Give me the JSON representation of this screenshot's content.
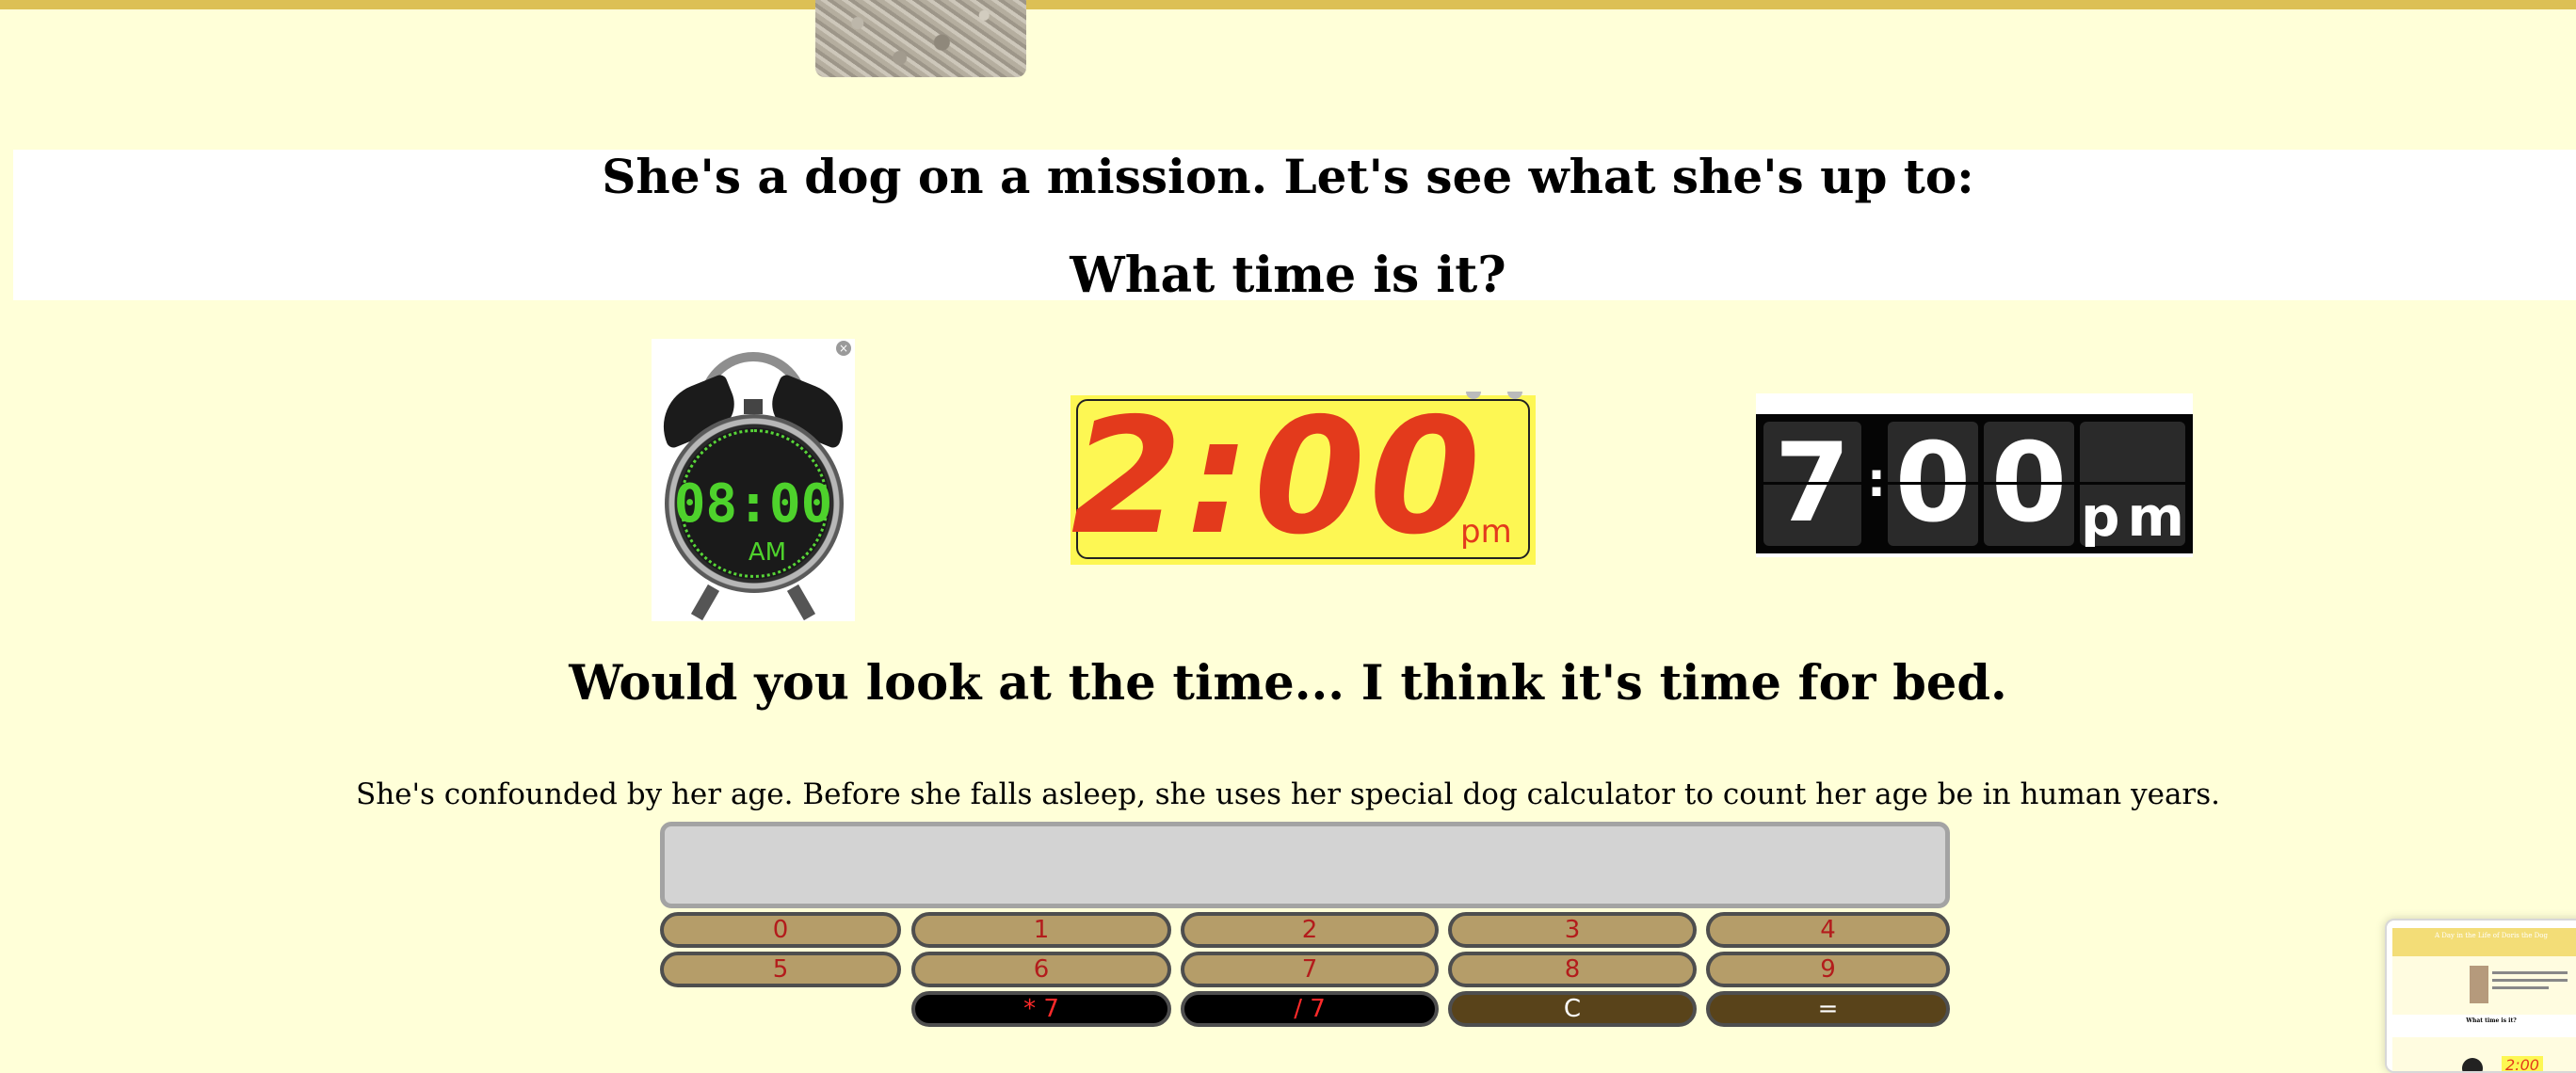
{
  "header": {
    "dog_photo_alt": "dog photo"
  },
  "headings": {
    "mission": "She's a dog on a mission. Let's see what she's up to:",
    "what_time": "What time is it?",
    "bedtime": "Would you look at the time... I think it's time for bed.",
    "age_paragraph": "She's confounded by her age. Before she falls asleep, she uses her special dog calculator to count her age be in human years."
  },
  "clocks": {
    "alarm": {
      "time": "08:00",
      "ampm": "AM",
      "close_glyph": "×",
      "color": "#4ed22c"
    },
    "digital": {
      "time": "2:00",
      "ampm": "pm",
      "color": "#e33a1c",
      "background": "#fdf753"
    },
    "flip": {
      "hour": "7",
      "colon": ":",
      "min_tens": "0",
      "min_ones": "0",
      "ampm": "pm"
    }
  },
  "calculator": {
    "display_value": "",
    "keys": {
      "k0": "0",
      "k1": "1",
      "k2": "2",
      "k3": "3",
      "k4": "4",
      "k5": "5",
      "k6": "6",
      "k7": "7",
      "k8": "8",
      "k9": "9",
      "times7": "* 7",
      "div7": "/ 7",
      "clear": "C",
      "equals": "="
    }
  },
  "thumbnail": {
    "title": "A Day in the Life of Doris the Dog",
    "heading": "What time is it?",
    "clock_text": "2:00"
  },
  "colors": {
    "page_background": "#ffffd8",
    "top_bar": "#dcc055",
    "key_number": "#b59d69",
    "key_operator": "#000000",
    "key_dark": "#59431a"
  }
}
